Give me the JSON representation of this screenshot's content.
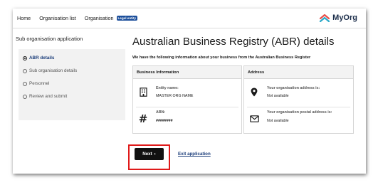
{
  "topnav": {
    "links": [
      "Home",
      "Organisation list",
      "Organisation"
    ],
    "badge": "Legal entity",
    "brand": "MyOrg"
  },
  "sidebar": {
    "heading": "Sub organisation application",
    "items": [
      {
        "label": "ABR details",
        "active": true
      },
      {
        "label": "Sub organisation details",
        "active": false
      },
      {
        "label": "Personnel",
        "active": false
      },
      {
        "label": "Review and submit",
        "active": false
      }
    ]
  },
  "main": {
    "title": "Australian Business Registry (ABR) details",
    "intro": "We have the following information about your business from the Australian Business Register",
    "business_card": {
      "header": "Business Information",
      "entity_label": "Entity name:",
      "entity_value": "MASTER ORG NAME",
      "abn_label": "ABN:",
      "abn_value": "########"
    },
    "address_card": {
      "header": "Address",
      "address_label": "Your organisation address is:",
      "address_value": "Not available",
      "postal_label": "Your organisation postal address is:",
      "postal_value": "Not available"
    }
  },
  "actions": {
    "next_label": "Next",
    "next_chevron": "›",
    "exit_label": "Exit application"
  },
  "colors": {
    "brand_navy": "#1b2d4a",
    "badge_blue": "#1b4e9b",
    "highlight_red": "#e01a1a",
    "button_black": "#111111"
  }
}
